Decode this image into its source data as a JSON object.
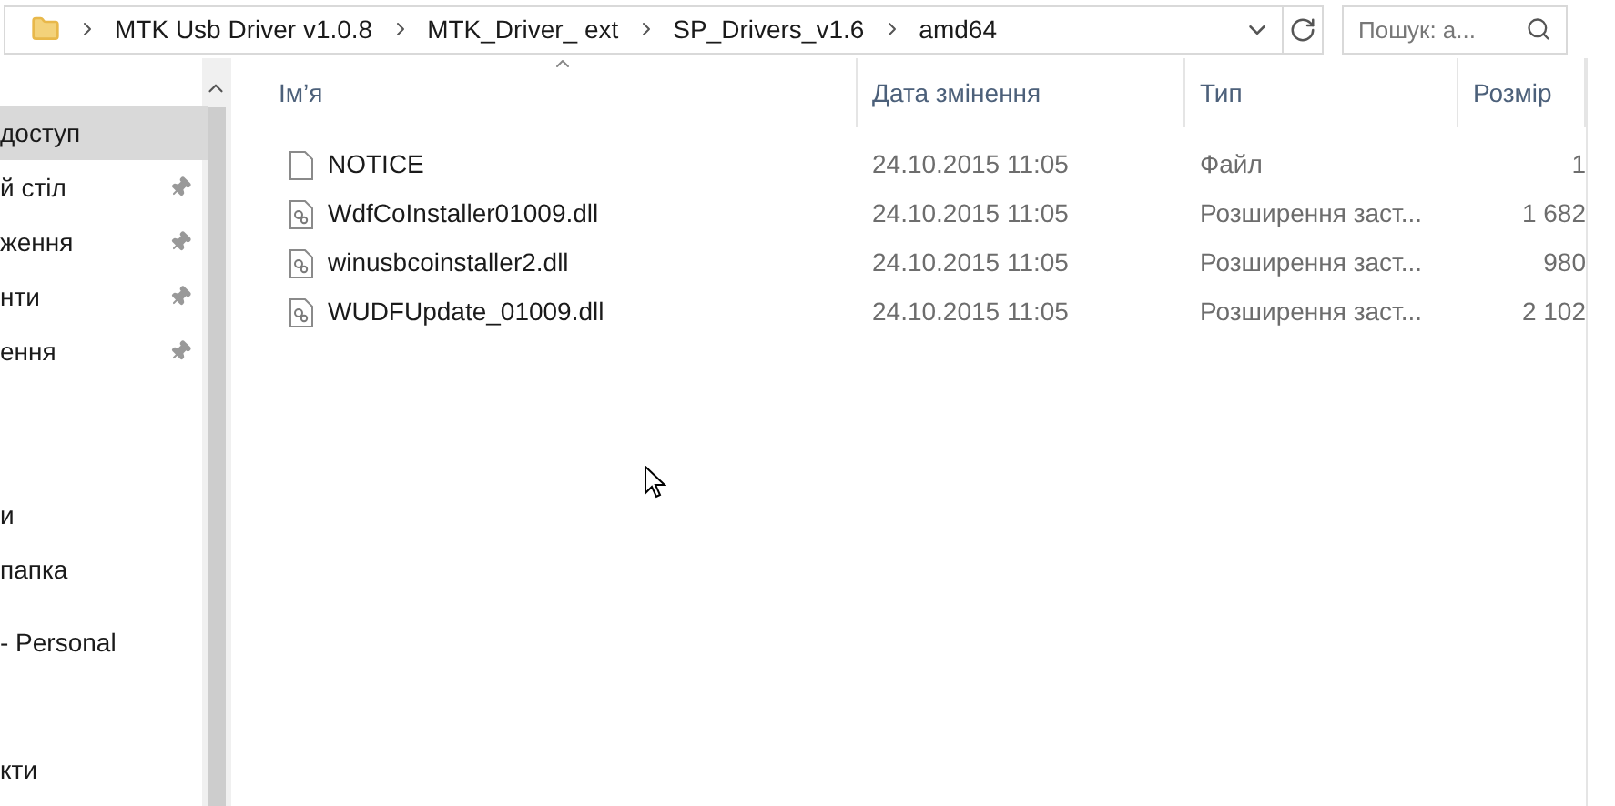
{
  "breadcrumb": [
    "MTK Usb Driver v1.0.8",
    "MTK_Driver_ ext",
    "SP_Drivers_v1.6",
    "amd64"
  ],
  "search": {
    "placeholder": "Пошук: a..."
  },
  "sidebar": {
    "items": [
      {
        "label": "доступ",
        "selected": true,
        "pinned": false
      },
      {
        "label": "й стіл",
        "selected": false,
        "pinned": true
      },
      {
        "label": "ження",
        "selected": false,
        "pinned": true
      },
      {
        "label": "нти",
        "selected": false,
        "pinned": true
      },
      {
        "label": "ення",
        "selected": false,
        "pinned": true
      },
      {
        "label": "и",
        "selected": false,
        "pinned": false
      },
      {
        "label": "папка",
        "selected": false,
        "pinned": false
      },
      {
        "label": "- Personal",
        "selected": false,
        "pinned": false
      },
      {
        "label": "кти",
        "selected": false,
        "pinned": false
      }
    ]
  },
  "table": {
    "columns": [
      "Ім’я",
      "Дата змінення",
      "Тип",
      "Розмір"
    ],
    "rows": [
      {
        "kind": "file",
        "name": "NOTICE",
        "date": "24.10.2015 11:05",
        "type": "Файл",
        "size": "1"
      },
      {
        "kind": "dll",
        "name": "WdfCoInstaller01009.dll",
        "date": "24.10.2015 11:05",
        "type": "Розширення заст...",
        "size": "1 682"
      },
      {
        "kind": "dll",
        "name": "winusbcoinstaller2.dll",
        "date": "24.10.2015 11:05",
        "type": "Розширення заст...",
        "size": "980"
      },
      {
        "kind": "dll",
        "name": "WUDFUpdate_01009.dll",
        "date": "24.10.2015 11:05",
        "type": "Розширення заст...",
        "size": "2 102"
      }
    ]
  }
}
